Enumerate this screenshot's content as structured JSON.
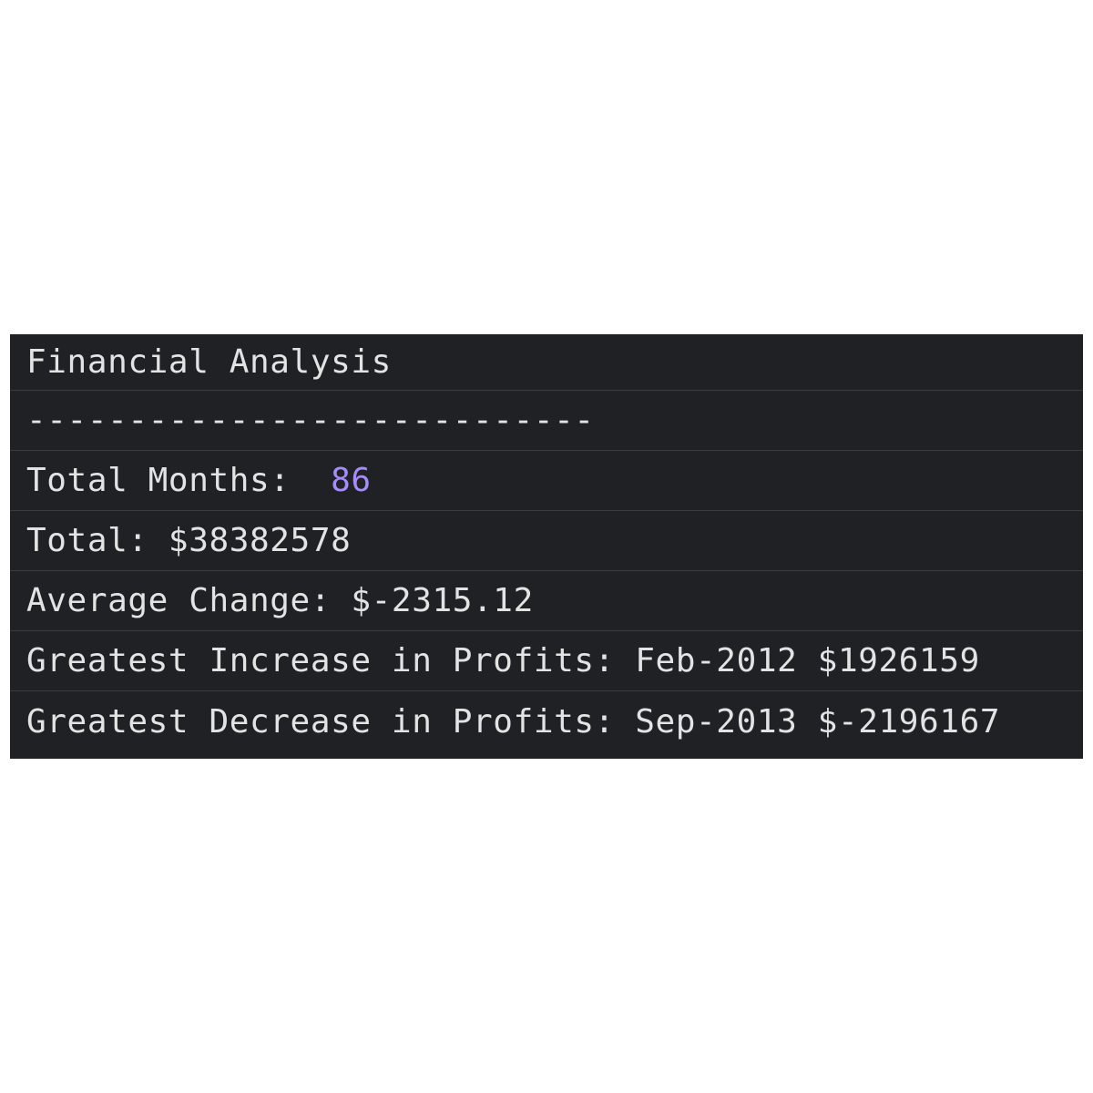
{
  "console": {
    "lines": [
      {
        "text": "Financial Analysis"
      },
      {
        "text": "----------------------------"
      },
      {
        "label": "Total Months:  ",
        "value": "86"
      },
      {
        "text": "Total: $38382578"
      },
      {
        "text": "Average Change: $-2315.12"
      },
      {
        "text": "Greatest Increase in Profits: Feb-2012 $1926159"
      },
      {
        "text": "Greatest Decrease in Profits: Sep-2013 $-2196167"
      }
    ],
    "colors": {
      "background": "#202124",
      "text": "#e3e3e3",
      "number": "#a78bfa",
      "divider": "#3a3b3e"
    }
  }
}
